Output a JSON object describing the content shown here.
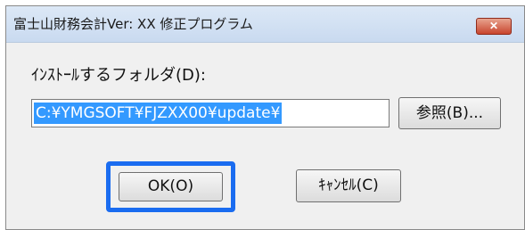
{
  "window": {
    "title": "富士山財務会計Ver: XX  修正プログラム",
    "close_icon": "close-icon",
    "close_glyph": "✕"
  },
  "form": {
    "folder_label": "ｲﾝｽﾄｰﾙするフォルダ(D):",
    "path_value": "C:¥YMGSOFT¥FJZXX00¥update¥"
  },
  "buttons": {
    "browse": "参照(B)...",
    "ok": "OK(O)",
    "cancel": "ｷｬﾝｾﾙ(C)"
  },
  "colors": {
    "focus_ring": "#1a6cf0",
    "selection": "#3399ff",
    "close_button": "#c8452e"
  }
}
